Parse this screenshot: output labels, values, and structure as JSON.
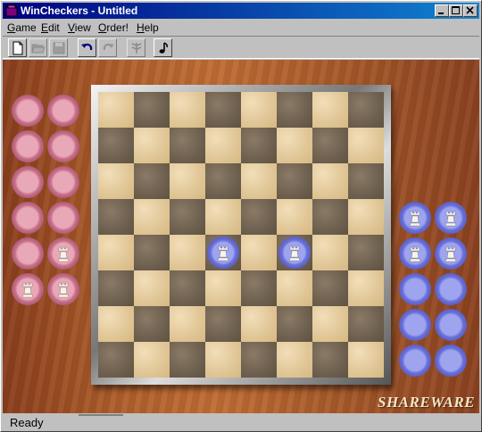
{
  "window": {
    "title": "WinCheckers - Untitled",
    "controls": [
      "minimize-icon",
      "maximize-icon",
      "close-icon"
    ]
  },
  "menu": [
    {
      "underline": "G",
      "rest": "ame"
    },
    {
      "underline": "E",
      "rest": "dit"
    },
    {
      "underline": "V",
      "rest": "iew"
    },
    {
      "underline": "O",
      "rest": "rder!"
    },
    {
      "underline": "H",
      "rest": "elp"
    }
  ],
  "toolbar": {
    "buttons": [
      {
        "icon": "new-document-icon",
        "enabled": true
      },
      {
        "icon": "open-folder-icon",
        "enabled": false
      },
      {
        "icon": "save-disk-icon",
        "enabled": false
      },
      {
        "icon": "undo-arrow-icon",
        "enabled": true
      },
      {
        "icon": "redo-arrow-icon",
        "enabled": false
      },
      {
        "icon": "hint-tree-icon",
        "enabled": false
      },
      {
        "icon": "music-note-icon",
        "enabled": true
      }
    ]
  },
  "board": {
    "size": 8,
    "light_color": "#e6cc9c",
    "dark_color": "#6e604f",
    "pieces": [
      {
        "color": "blue",
        "king": true,
        "row": 4,
        "col": 3
      },
      {
        "color": "blue",
        "king": true,
        "row": 4,
        "col": 5
      }
    ]
  },
  "captured": {
    "pink": {
      "colors": "#c8708a",
      "rows": [
        [
          false,
          false
        ],
        [
          false,
          false
        ],
        [
          false,
          false
        ],
        [
          false,
          false
        ],
        [
          false,
          true
        ],
        [
          true,
          true
        ]
      ]
    },
    "blue": {
      "colors": "#6a70d8",
      "rows": [
        [
          true,
          true
        ],
        [
          true,
          true
        ],
        [
          false,
          false
        ],
        [
          false,
          false
        ],
        [
          false,
          false
        ]
      ]
    }
  },
  "watermark": "SHAREWARE",
  "status": {
    "text": "Ready"
  }
}
